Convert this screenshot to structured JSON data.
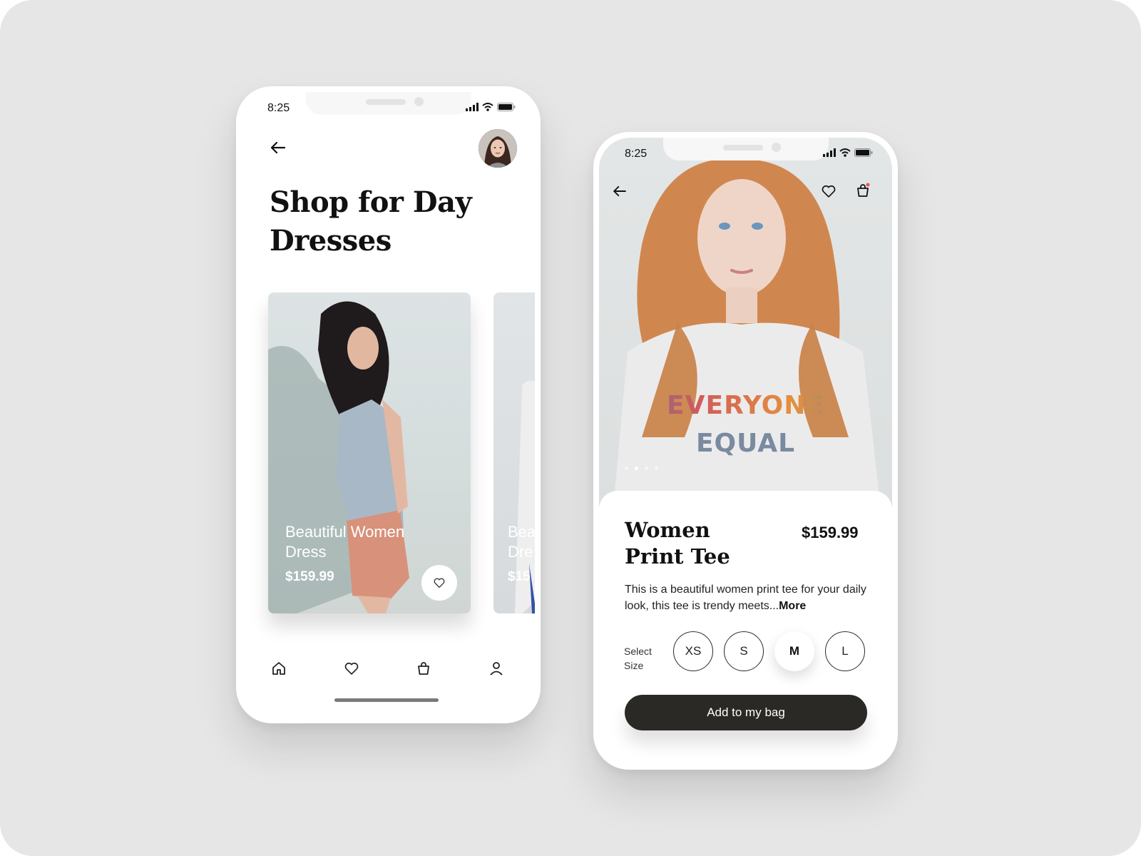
{
  "phone_list": {
    "status_time": "8:25",
    "title": "Shop for Day Dresses",
    "products": [
      {
        "name": "Beautiful Women Dress",
        "price": "$159.99"
      },
      {
        "name": "Bea Dre",
        "price": "$15"
      }
    ],
    "tabs": [
      "home-icon",
      "heart-icon",
      "bag-icon",
      "user-icon"
    ]
  },
  "phone_detail": {
    "status_time": "8:25",
    "shirt_print": [
      "EVERYONE",
      "EQUAL"
    ],
    "product_name": "Women Print Tee",
    "price": "$159.99",
    "description": "This is a beautiful women print tee for your daily look, this tee is trendy meets...",
    "more_label": "More",
    "size_label": "Select Size",
    "sizes": [
      "XS",
      "S",
      "M",
      "L"
    ],
    "selected_size": "M",
    "cta_label": "Add to my bag",
    "image_dots": 4,
    "active_dot": 2
  },
  "colors": {
    "background": "#e6e6e6",
    "cta": "#2a2926",
    "text_dark": "#111111",
    "cart_badge": "#e8554a"
  }
}
